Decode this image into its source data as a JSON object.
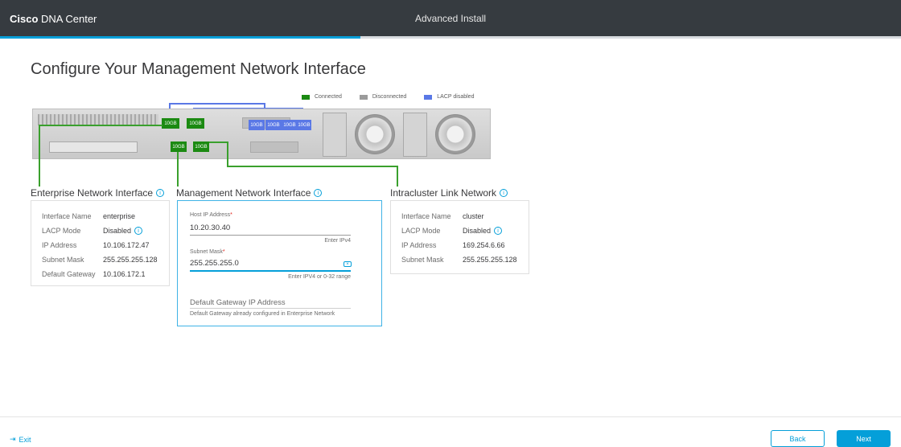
{
  "header": {
    "brand_bold": "Cisco",
    "brand_rest": " DNA Center",
    "title": "Advanced Install",
    "progress_fraction": 0.4
  },
  "page": {
    "title": "Configure Your Management Network Interface"
  },
  "legend": [
    {
      "label": "Connected",
      "color": "#1b8a12"
    },
    {
      "label": "Disconnected",
      "color": "#9b9b9b"
    },
    {
      "label": "LACP disabled",
      "color": "#5a78e6"
    }
  ],
  "server": {
    "ports": {
      "p1": "10GB",
      "p2": "10GB",
      "p3": "10GB",
      "p4": "10GB",
      "p5": "10GB",
      "p6": "10GB",
      "p7": "10GB",
      "p8": "10GB"
    }
  },
  "enterprise": {
    "title": "Enterprise Network Interface",
    "rows": [
      {
        "k": "Interface Name",
        "v": "enterprise"
      },
      {
        "k": "LACP Mode",
        "v": "Disabled"
      },
      {
        "k": "IP Address",
        "v": "10.106.172.47"
      },
      {
        "k": "Subnet Mask",
        "v": "255.255.255.128"
      },
      {
        "k": "Default Gateway",
        "v": "10.106.172.1"
      }
    ]
  },
  "management": {
    "title": "Management Network Interface",
    "host_ip_label": "Host IP Address",
    "host_ip_value": "10.20.30.40",
    "host_ip_help": "Enter IPv4",
    "subnet_label": "Subnet Mask",
    "subnet_value": "255.255.255.0",
    "subnet_help": "Enter IPV4 or 0-32 range",
    "gateway_label": "Default Gateway IP Address",
    "gateway_help": "Default Gateway already configured in Enterprise Network",
    "required_mark": "*"
  },
  "intracluster": {
    "title": "Intracluster Link Network",
    "rows": [
      {
        "k": "Interface Name",
        "v": "cluster"
      },
      {
        "k": "LACP Mode",
        "v": "Disabled"
      },
      {
        "k": "IP Address",
        "v": "169.254.6.66"
      },
      {
        "k": "Subnet Mask",
        "v": "255.255.255.128"
      }
    ]
  },
  "footer": {
    "exit": "Exit",
    "back": "Back",
    "next": "Next"
  }
}
